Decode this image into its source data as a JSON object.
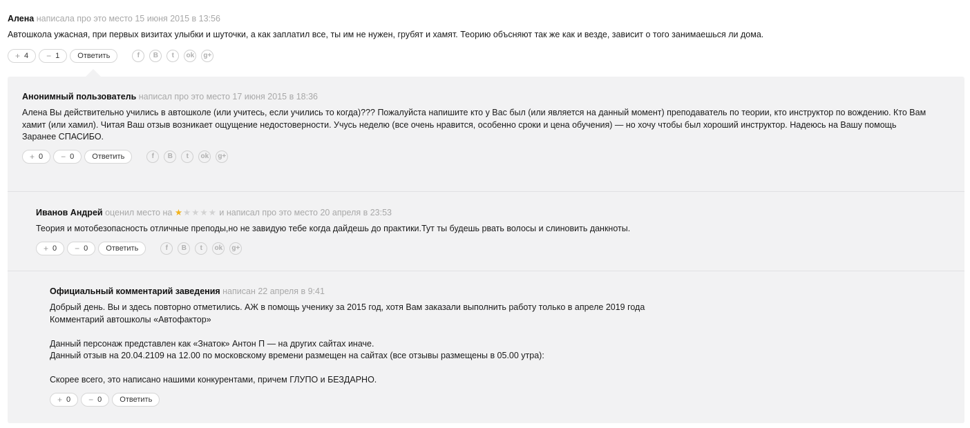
{
  "comments": [
    {
      "author": "Алена",
      "meta": "написала про это место 15 июня 2015 в 13:56",
      "text": [
        "Автошкола ужасная, при первых визитах улыбки и шуточки, а как заплатил все, ты им не нужен, грубят и хамят. Теорию объсняют так же как и везде, зависит о того занимаешься ли дома."
      ],
      "plus": "4",
      "minus": "1",
      "reply": "Ответить"
    },
    {
      "author": "Анонимный пользователь",
      "meta": "написал про это место 17 июня 2015 в 18:36",
      "text": [
        "Алена Вы действительно учились в автошколе (или учитесь, если учились то когда)??? Пожалуйста напишите кто у Вас был (или является на данный момент) преподаватель по теории, кто инструктор по вождению. Кто Вам хамит (или хамил). Читая Ваш отзыв возникает ощущение недостоверности. Учусь неделю (все очень нравится, особенно сроки и цена обучения) — но хочу чтобы был хороший инструктор. Надеюсь на Вашу помощь",
        "Заранее СПАСИБО."
      ],
      "plus": "0",
      "minus": "0",
      "reply": "Ответить"
    },
    {
      "author": "Иванов Андрей",
      "meta_prefix": "оценил место на",
      "rating": 1,
      "rating_max": 5,
      "meta": "и написал про это место 20 апреля в 23:53",
      "text": [
        "Теория и мотобезопасность отличные преподы,но не завидую тебе когда дайдешь до практики.Тут ты будешь рвать волосы и слиновить данкноты."
      ],
      "plus": "0",
      "minus": "0",
      "reply": "Ответить"
    },
    {
      "author": "Официальный комментарий заведения",
      "meta": "написан 22 апреля в 9:41",
      "text": [
        "Добрый день. Вы и здесь повторно отметились. АЖ в помощь ученику за 2015 год, хотя Вам заказали выполнить работу только в апреле 2019 года",
        "Комментарий автошколы «Автофактор»",
        "",
        "Данный персонаж представлен как «Знаток» Антон П — на других сайтах иначе.",
        "Данный отзыв на 20.04.2109 на 12.00 по московскому времени размещен на сайтах (все отзывы размещены в 05.00 утра):",
        "",
        "Скорее всего, это написано нашими конкурентами, причем ГЛУПО и БЕЗДАРНО."
      ],
      "plus": "0",
      "minus": "0",
      "reply": "Ответить"
    }
  ],
  "socials": [
    {
      "icon": "facebook-icon",
      "glyph": "f"
    },
    {
      "icon": "vkontakte-icon",
      "glyph": "B"
    },
    {
      "icon": "twitter-icon",
      "glyph": "t"
    },
    {
      "icon": "odnoklassniki-icon",
      "glyph": "ok"
    },
    {
      "icon": "google-plus-icon",
      "glyph": "g+"
    }
  ],
  "vote_signs": {
    "plus": "+",
    "minus": "−"
  },
  "colors": {
    "thread_bg": "#f2f2f3",
    "star": "#f2b21b",
    "muted_text": "#a8a8a8"
  }
}
